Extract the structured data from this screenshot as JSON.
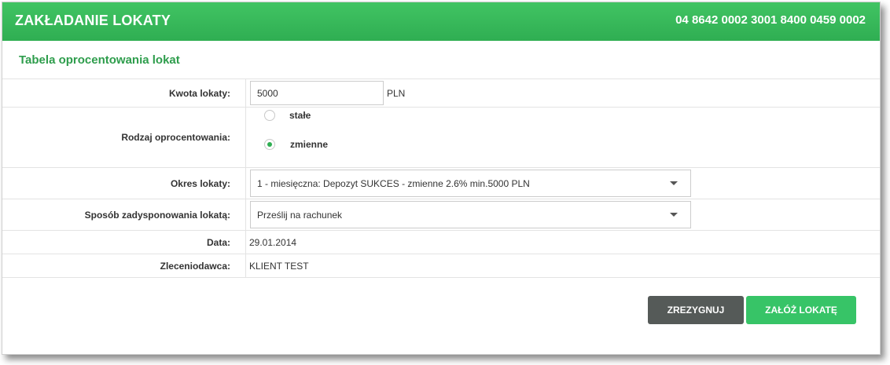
{
  "header": {
    "title": "ZAKŁADANIE LOKATY",
    "account_number": "04 8642 0002 3001 8400 0459 0002"
  },
  "section_title": "Tabela oprocentowania lokat",
  "form": {
    "amount": {
      "label": "Kwota lokaty:",
      "value": "5000",
      "unit": "PLN"
    },
    "interest_type": {
      "label": "Rodzaj oprocentowania:",
      "options": [
        {
          "label": "stałe",
          "selected": false
        },
        {
          "label": "zmienne",
          "selected": true
        }
      ]
    },
    "period": {
      "label": "Okres lokaty:",
      "selected": "1 - miesięczna: Depozyt SUKCES - zmienne 2.6% min.5000 PLN"
    },
    "disposition": {
      "label": "Sposób zadysponowania lokatą:",
      "selected": "Prześlij na rachunek"
    },
    "date": {
      "label": "Data:",
      "value": "29.01.2014"
    },
    "client": {
      "label": "Zleceniodawca:",
      "value": "KLIENT TEST"
    }
  },
  "buttons": {
    "cancel_label": "ZREZYGNUJ",
    "submit_label": "ZAŁÓŻ LOKATĘ"
  },
  "colors": {
    "header_green": "#38b95a",
    "title_green": "#2e9d4c",
    "submit_green": "#37c467",
    "cancel_gray": "#555a58"
  },
  "icons": {
    "dropdown": "chevron-down-icon",
    "radio": "radio-button"
  }
}
